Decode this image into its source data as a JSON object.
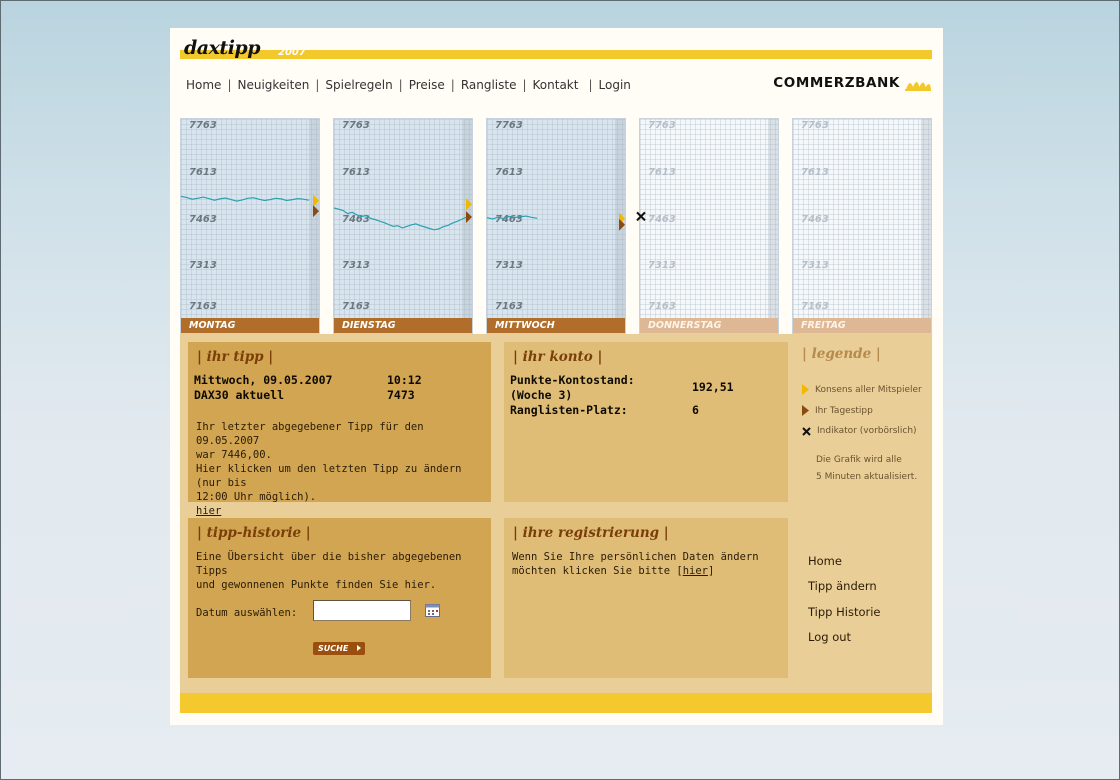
{
  "header": {
    "logo_text": "daxtipp",
    "logo_year": "2007",
    "nav": [
      "Home",
      "Neuigkeiten",
      "Spielregeln",
      "Preise",
      "Rangliste",
      "Kontakt",
      "Login"
    ],
    "bank_name": "COMMERZBANK"
  },
  "colors": {
    "accent_yellow": "#f3c82b",
    "label_brown": "#b06e2a",
    "line_teal": "#2aa0b0",
    "consensus_marker": "#f0b800",
    "daily_tip_marker": "#8a4a10"
  },
  "chart_data": {
    "type": "line",
    "categories": [
      "MONTAG",
      "DIENSTAG",
      "MITTWOCH",
      "DONNERSTAG",
      "FREITAG"
    ],
    "y_ticks": [
      "7763",
      "7613",
      "7463",
      "7313",
      "7163"
    ],
    "ylim": [
      7163,
      7763
    ],
    "series": [
      {
        "day": "MONTAG",
        "values": [
          7537,
          7534,
          7528,
          7531,
          7535,
          7530,
          7525,
          7529,
          7532,
          7527,
          7522,
          7526,
          7531,
          7533,
          7528,
          7524,
          7527,
          7531,
          7529,
          7524,
          7527,
          7530,
          7528,
          7525
        ],
        "consensus": 7523,
        "daily_tip": 7490
      },
      {
        "day": "DIENSTAG",
        "values": [
          7500,
          7496,
          7492,
          7482,
          7486,
          7478,
          7472,
          7476,
          7467,
          7463,
          7458,
          7453,
          7447,
          7441,
          7443,
          7436,
          7441,
          7446,
          7449,
          7443,
          7439,
          7434,
          7430,
          7433,
          7440,
          7444,
          7451,
          7457,
          7463,
          7470
        ],
        "consensus": 7512,
        "daily_tip": 7471
      },
      {
        "day": "MITTWOCH",
        "values": [
          7469,
          7465,
          7470,
          7466,
          7473,
          7469,
          7472,
          7474,
          7470,
          7467
        ],
        "consensus": 7466,
        "daily_tip": 7446
      },
      {
        "day": "DONNERSTAG",
        "values": [],
        "indicator": 7473
      },
      {
        "day": "FREITAG",
        "values": []
      }
    ]
  },
  "tipp": {
    "title": "| ihr tipp |",
    "date_label": "Mittwoch, 09.05.2007",
    "time": "10:12",
    "dax_label": "DAX30 aktuell",
    "dax_value": "7473",
    "text1": "Ihr letzter abgegebener Tipp für den 09.05.2007",
    "text2": "war 7446,00.",
    "text3": "Hier klicken um den letzten Tipp zu ändern (nur bis",
    "text4": "12:00 Uhr möglich).",
    "link": "hier"
  },
  "konto": {
    "title": "| ihr konto |",
    "stand_label_1": "Punkte-Kontostand:",
    "stand_label_2": "(Woche 3)",
    "stand_value": "192,51",
    "rang_label": "Ranglisten-Platz:",
    "rang_value": "6"
  },
  "legende": {
    "title": "| legende |",
    "items": [
      "Konsens aller Mitspieler",
      "Ihr Tagestipp",
      "Indikator (vorbörslich)"
    ],
    "note_1": "Die Grafik wird alle",
    "note_2": "5 Minuten aktualisiert."
  },
  "historie": {
    "title": "| tipp-historie |",
    "text1": "Eine Übersicht über die bisher abgegebenen Tipps",
    "text2": "und gewonnenen Punkte finden Sie hier.",
    "date_label": "Datum auswählen:",
    "date_value": "",
    "button": "SUCHE"
  },
  "registrierung": {
    "title": "| ihre registrierung |",
    "text1": "Wenn Sie Ihre persönlichen Daten ändern",
    "text2_pre": "möchten klicken Sie bitte [",
    "text2_link": "hier",
    "text2_post": "]"
  },
  "side_nav": [
    "Home",
    "Tipp ändern",
    "Tipp Historie",
    "Log out"
  ]
}
